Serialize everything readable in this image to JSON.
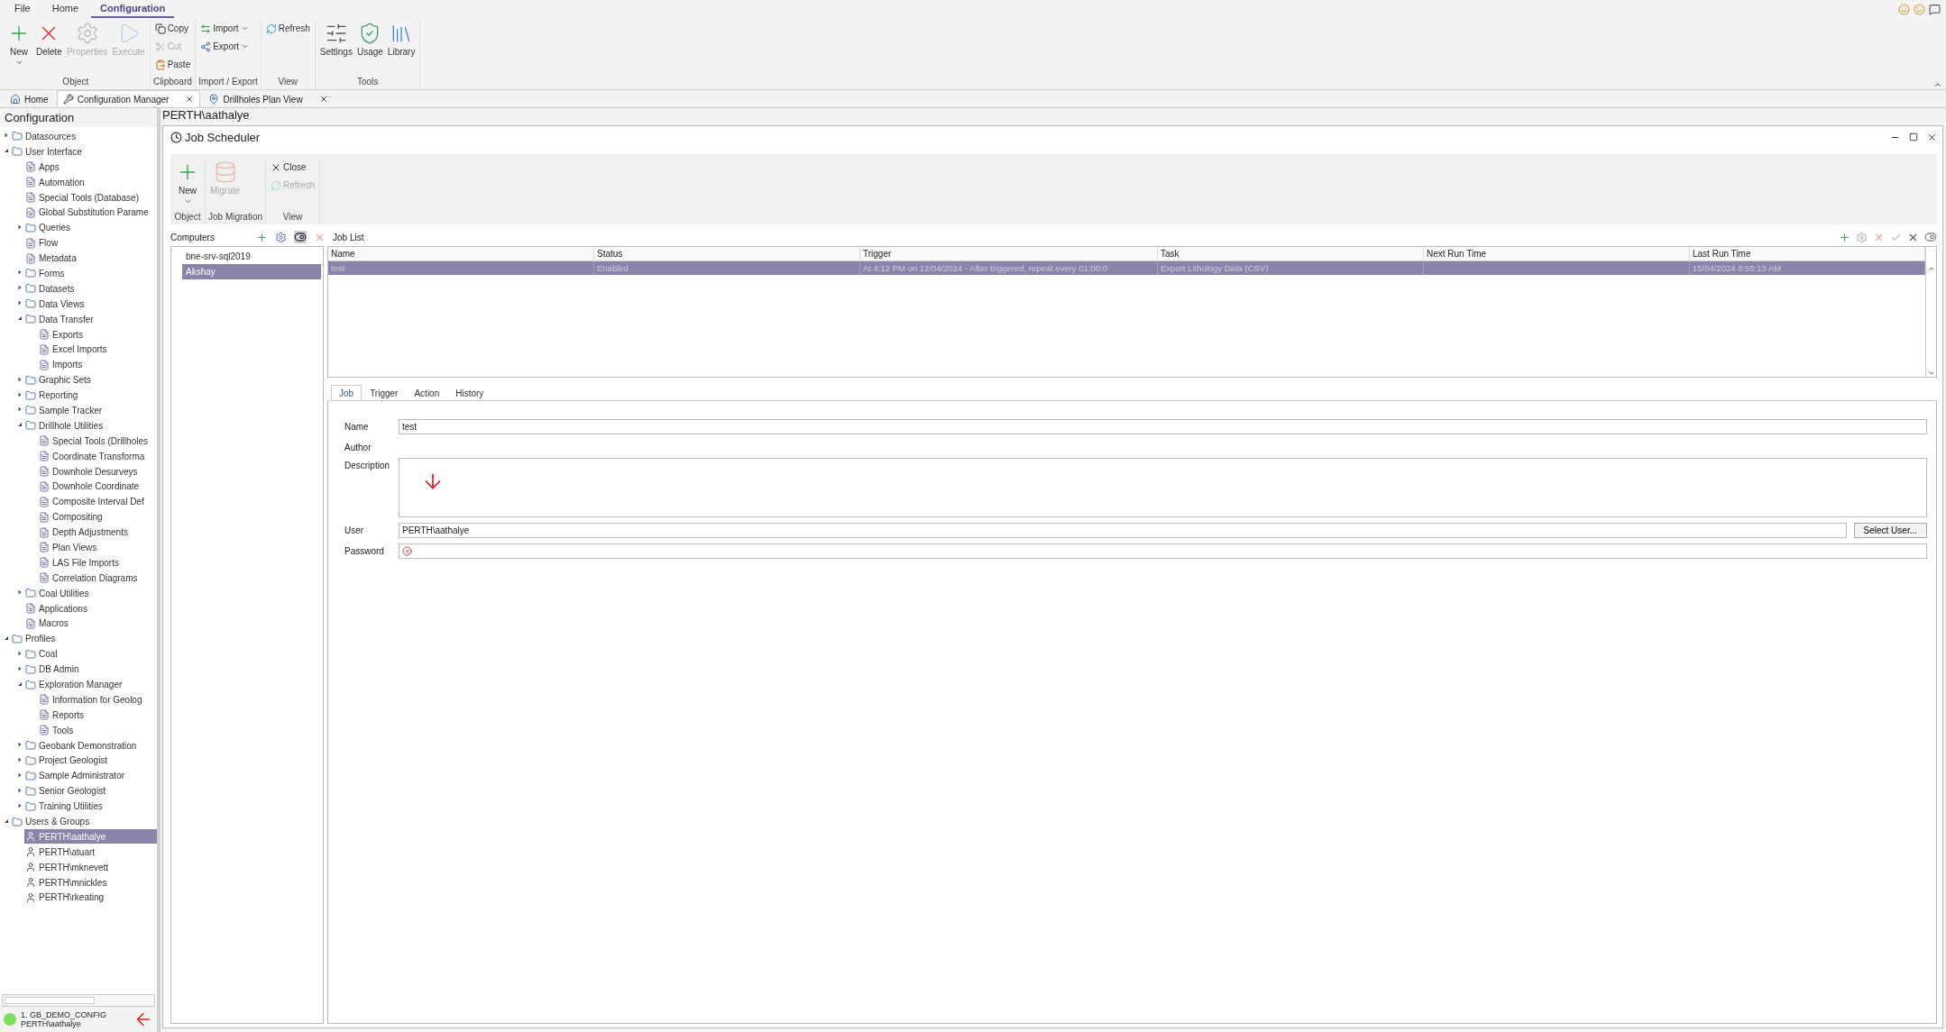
{
  "ribbon": {
    "tabs": [
      {
        "label": "File",
        "selected": false
      },
      {
        "label": "Home",
        "selected": false
      },
      {
        "label": "Configuration",
        "selected": true
      }
    ],
    "groups": [
      {
        "label": "Object",
        "buttons": [
          {
            "label": "New",
            "kind": "large",
            "disabled": false,
            "dropdown": true
          },
          {
            "label": "Delete",
            "kind": "large",
            "disabled": false,
            "dropdown": false
          },
          {
            "label": "Properties",
            "kind": "large",
            "disabled": true,
            "dropdown": false
          },
          {
            "label": "Execute",
            "kind": "large",
            "disabled": true,
            "dropdown": false
          }
        ]
      },
      {
        "label": "Clipboard",
        "buttons": [
          {
            "label": "Copy",
            "kind": "small",
            "disabled": false,
            "dropdown": false
          },
          {
            "label": "Cut",
            "kind": "small",
            "disabled": true,
            "dropdown": false
          },
          {
            "label": "Paste",
            "kind": "small",
            "disabled": false,
            "dropdown": false
          }
        ]
      },
      {
        "label": "Import / Export",
        "buttons": [
          {
            "label": "Import",
            "kind": "small",
            "disabled": false,
            "dropdown": true
          },
          {
            "label": "Export",
            "kind": "small",
            "disabled": false,
            "dropdown": true
          }
        ]
      },
      {
        "label": "View",
        "buttons": [
          {
            "label": "Refresh",
            "kind": "small",
            "disabled": false,
            "dropdown": false
          }
        ]
      },
      {
        "label": "Tools",
        "buttons": [
          {
            "label": "Settings",
            "kind": "large",
            "disabled": false,
            "dropdown": false
          },
          {
            "label": "Usage",
            "kind": "large",
            "disabled": false,
            "dropdown": false
          },
          {
            "label": "Library",
            "kind": "large",
            "disabled": false,
            "dropdown": false
          }
        ]
      }
    ]
  },
  "document_tabs": [
    {
      "label": "Home",
      "selected": false,
      "closable": false
    },
    {
      "label": "Configuration Manager",
      "selected": true,
      "closable": true
    },
    {
      "label": "Drillholes Plan View",
      "selected": false,
      "closable": true
    }
  ],
  "sidebar": {
    "title": "Configuration",
    "tree": [
      {
        "label": "Datasources",
        "kind": "branch",
        "expanded": false,
        "selected": false
      },
      {
        "label": "User Interface",
        "kind": "branch",
        "expanded": true,
        "selected": false,
        "children": [
          {
            "label": "Apps",
            "kind": "leaf",
            "selected": false
          },
          {
            "label": "Automation",
            "kind": "leaf",
            "selected": false
          },
          {
            "label": "Special Tools (Database)",
            "kind": "leaf",
            "selected": false
          },
          {
            "label": "Global Substitution Parame",
            "kind": "leaf",
            "selected": false
          },
          {
            "label": "Queries",
            "kind": "branch",
            "expanded": false,
            "selected": false
          },
          {
            "label": "Flow",
            "kind": "leaf",
            "selected": false
          },
          {
            "label": "Metadata",
            "kind": "leaf",
            "selected": false
          },
          {
            "label": "Forms",
            "kind": "branch",
            "expanded": false,
            "selected": false
          },
          {
            "label": "Datasets",
            "kind": "branch",
            "expanded": false,
            "selected": false
          },
          {
            "label": "Data Views",
            "kind": "branch",
            "expanded": false,
            "selected": false
          },
          {
            "label": "Data Transfer",
            "kind": "branch",
            "expanded": true,
            "selected": false,
            "children": [
              {
                "label": "Exports",
                "kind": "leaf",
                "selected": false
              },
              {
                "label": "Excel Imports",
                "kind": "leaf",
                "selected": false
              },
              {
                "label": "Imports",
                "kind": "leaf",
                "selected": false
              }
            ]
          },
          {
            "label": "Graphic Sets",
            "kind": "branch",
            "expanded": false,
            "selected": false
          },
          {
            "label": "Reporting",
            "kind": "branch",
            "expanded": false,
            "selected": false
          },
          {
            "label": "Sample Tracker",
            "kind": "branch",
            "expanded": false,
            "selected": false
          },
          {
            "label": "Drillhole Utilities",
            "kind": "branch",
            "expanded": true,
            "selected": false,
            "children": [
              {
                "label": "Special Tools (Drillholes",
                "kind": "leaf",
                "selected": false
              },
              {
                "label": "Coordinate Transforma",
                "kind": "leaf",
                "selected": false
              },
              {
                "label": "Downhole Desurveys",
                "kind": "leaf",
                "selected": false
              },
              {
                "label": "Downhole Coordinate",
                "kind": "leaf",
                "selected": false
              },
              {
                "label": "Composite Interval Def",
                "kind": "leaf",
                "selected": false
              },
              {
                "label": "Compositing",
                "kind": "leaf",
                "selected": false
              },
              {
                "label": "Depth Adjustments",
                "kind": "leaf",
                "selected": false
              },
              {
                "label": "Plan Views",
                "kind": "leaf",
                "selected": false
              },
              {
                "label": "LAS File Imports",
                "kind": "leaf",
                "selected": false
              },
              {
                "label": "Correlation Diagrams",
                "kind": "leaf",
                "selected": false
              }
            ]
          },
          {
            "label": "Coal Utilities",
            "kind": "branch",
            "expanded": false,
            "selected": false
          },
          {
            "label": "Applications",
            "kind": "leaf",
            "selected": false
          },
          {
            "label": "Macros",
            "kind": "leaf",
            "selected": false
          }
        ]
      },
      {
        "label": "Profiles",
        "kind": "branch",
        "expanded": true,
        "selected": false,
        "children": [
          {
            "label": "Coal",
            "kind": "branch",
            "expanded": false,
            "selected": false
          },
          {
            "label": "DB Admin",
            "kind": "branch",
            "expanded": false,
            "selected": false
          },
          {
            "label": "Exploration Manager",
            "kind": "branch",
            "expanded": true,
            "selected": false,
            "children": [
              {
                "label": "Information for Geolog",
                "kind": "leaf",
                "selected": false
              },
              {
                "label": "Reports",
                "kind": "leaf",
                "selected": false
              },
              {
                "label": "Tools",
                "kind": "leaf",
                "selected": false
              }
            ]
          },
          {
            "label": "Geobank Demonstration",
            "kind": "branch",
            "expanded": false,
            "selected": false
          },
          {
            "label": "Project Geologist",
            "kind": "branch",
            "expanded": false,
            "selected": false
          },
          {
            "label": "Sample Administrator",
            "kind": "branch",
            "expanded": false,
            "selected": false
          },
          {
            "label": "Senior Geologist",
            "kind": "branch",
            "expanded": false,
            "selected": false
          },
          {
            "label": "Training Utilities",
            "kind": "branch",
            "expanded": false,
            "selected": false
          }
        ]
      },
      {
        "label": "Users & Groups",
        "kind": "branch",
        "expanded": true,
        "selected": false,
        "children": [
          {
            "label": "PERTH\\aathalye",
            "kind": "user",
            "selected": true
          },
          {
            "label": "PERTH\\atuart",
            "kind": "user",
            "selected": false
          },
          {
            "label": "PERTH\\mknevett",
            "kind": "user",
            "selected": false
          },
          {
            "label": "PERTH\\mnickles",
            "kind": "user",
            "selected": false
          },
          {
            "label": "PERTH\\rkeating",
            "kind": "user",
            "selected": false
          }
        ]
      }
    ]
  },
  "connection": {
    "database": "1. GB_DEMO_CONFIG",
    "user": "PERTH\\aathalye",
    "connected": true
  },
  "content_header": "PERTH\\aathalye",
  "job_scheduler": {
    "title": "Job Scheduler",
    "toolbar_groups": [
      {
        "label": "Object",
        "buttons": [
          {
            "label": "New",
            "kind": "large",
            "disabled": false,
            "dropdown": true
          }
        ]
      },
      {
        "label": "Job Migration",
        "buttons": [
          {
            "label": "Migrate",
            "kind": "large",
            "disabled": true,
            "dropdown": false
          }
        ]
      },
      {
        "label": "View",
        "buttons": [
          {
            "label": "Close",
            "kind": "small",
            "disabled": false,
            "dropdown": false
          },
          {
            "label": "Refresh",
            "kind": "small",
            "disabled": true,
            "dropdown": false
          }
        ]
      }
    ],
    "computers": {
      "title": "Computers",
      "items": [
        {
          "label": "bne-srv-sql2019",
          "selected": false
        },
        {
          "label": "Akshay",
          "selected": true
        }
      ]
    },
    "job_list": {
      "title": "Job List",
      "columns": [
        "Name",
        "Status",
        "Trigger",
        "Task",
        "Next Run Time",
        "Last Run Time"
      ],
      "rows": [
        {
          "cells": [
            "test",
            "Enabled",
            "At 4:12 PM on 12/04/2024 - After triggered, repeat every 01:00:0",
            "Export Lithology Data (CSV)",
            "",
            "15/04/2024 8:55:13 AM"
          ],
          "selected": true
        }
      ]
    },
    "detail_tabs": [
      {
        "label": "Job",
        "selected": true
      },
      {
        "label": "Trigger",
        "selected": false
      },
      {
        "label": "Action",
        "selected": false
      },
      {
        "label": "History",
        "selected": false
      }
    ],
    "form": {
      "name": {
        "label": "Name",
        "value": "test"
      },
      "author": {
        "label": "Author"
      },
      "description": {
        "label": "Description"
      },
      "user": {
        "label": "User",
        "value": "PERTH\\aathalye",
        "button": "Select User..."
      },
      "password": {
        "label": "Password",
        "error": true
      }
    }
  }
}
